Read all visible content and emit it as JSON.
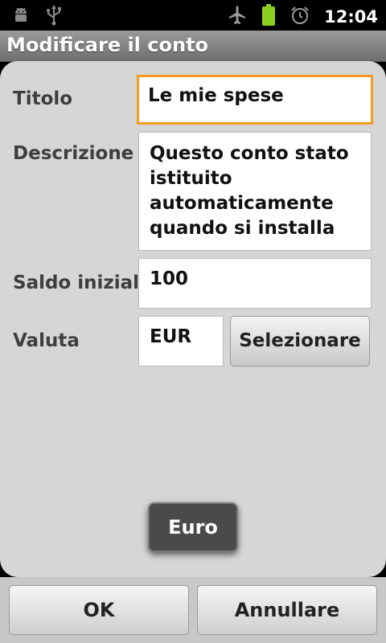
{
  "status_bar": {
    "time": "12:04",
    "icons": [
      "android-debug-icon",
      "usb-icon",
      "airplane-icon",
      "battery-icon",
      "alarm-icon"
    ]
  },
  "title": "Modificare il conto",
  "form": {
    "title_label": "Titolo",
    "title_value": "Le mie spese",
    "description_label": "Descrizione",
    "description_value": "Questo conto stato istituito automaticamente quando si installa",
    "balance_label": "Saldo inizial",
    "balance_value": "100",
    "currency_label": "Valuta",
    "currency_value": "EUR",
    "select_button": "Selezionare"
  },
  "toast": "Euro",
  "buttons": {
    "ok": "OK",
    "cancel": "Annullare"
  },
  "colors": {
    "focus_accent": "#f59a23",
    "battery": "#8ccf1e"
  }
}
